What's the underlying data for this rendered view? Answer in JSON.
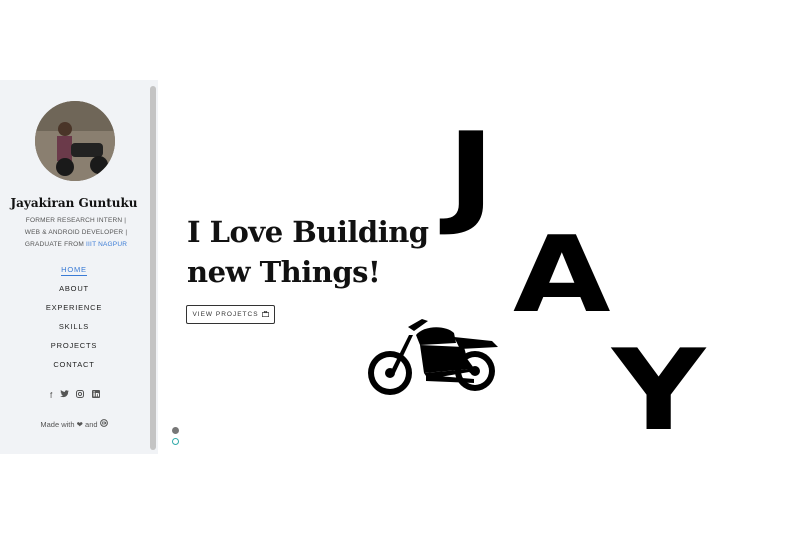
{
  "sidebar": {
    "name": "Jayakiran Guntuku",
    "bio_line1": "FORMER RESEARCH INTERN |",
    "bio_line2": "WEB & ANDROID DEVELOPER |",
    "bio_line3_prefix": "GRADUATE FROM",
    "bio_link": "IIIT NAGPUR",
    "nav": [
      {
        "label": "HOME",
        "active": true
      },
      {
        "label": "ABOUT",
        "active": false
      },
      {
        "label": "EXPERIENCE",
        "active": false
      },
      {
        "label": "SKILLS",
        "active": false
      },
      {
        "label": "PROJECTS",
        "active": false
      },
      {
        "label": "CONTACT",
        "active": false
      }
    ],
    "social_icons": [
      "facebook-icon",
      "twitter-icon",
      "instagram-icon",
      "linkedin-icon"
    ],
    "made_with_prefix": "Made with",
    "made_with_and": "and"
  },
  "hero": {
    "headline_line1": "I Love Building",
    "headline_line2": "new Things!",
    "button_label": "VIEW PROJETCS",
    "letters": [
      "J",
      "A",
      "Y"
    ]
  },
  "colors": {
    "accent": "#3a7bd5",
    "sidebar_bg": "#f1f3f6"
  }
}
